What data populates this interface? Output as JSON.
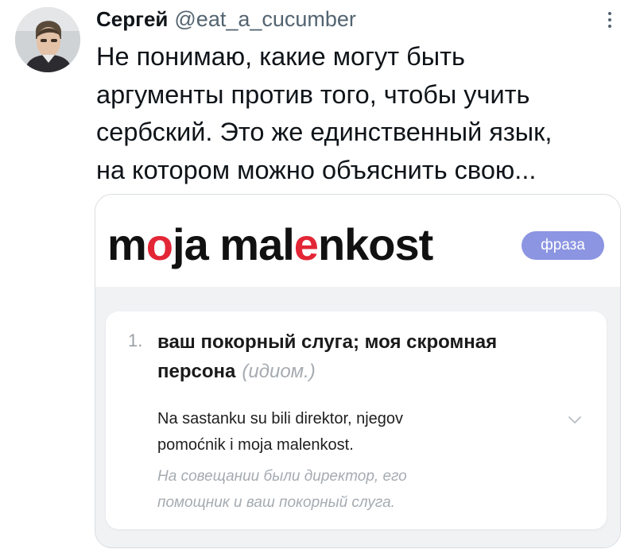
{
  "tweet": {
    "author_name": "Сергей",
    "author_handle": "@eat_a_cucumber",
    "text_lines": [
      "Не понимаю, какие могут быть",
      "аргументы против того, чтобы учить",
      "сербский. Это же единственный язык,",
      "на котором можно объяснить свою..."
    ]
  },
  "dictionary": {
    "headword_parts": [
      "m",
      "o",
      "ja mal",
      "e",
      "nkost"
    ],
    "part_of_speech": "фраза",
    "entry": {
      "number": "1.",
      "definition_lines": [
        "ваш покорный слуга; моя скромная",
        "персона"
      ],
      "usage_label": "(идиом.)",
      "example_lines": [
        "Na sastanku su bili direktor, njegov",
        "pomoćnik i moja malenkost."
      ],
      "translation_lines": [
        "На совещании были директор, его",
        "помощник и ваш покорный слуга."
      ]
    }
  },
  "colors": {
    "headword_accent": "#e32636",
    "badge": "#8c95e2",
    "handle": "#536471"
  },
  "icons": [
    "avatar-photo",
    "more-options-icon",
    "chevron-down-icon"
  ]
}
